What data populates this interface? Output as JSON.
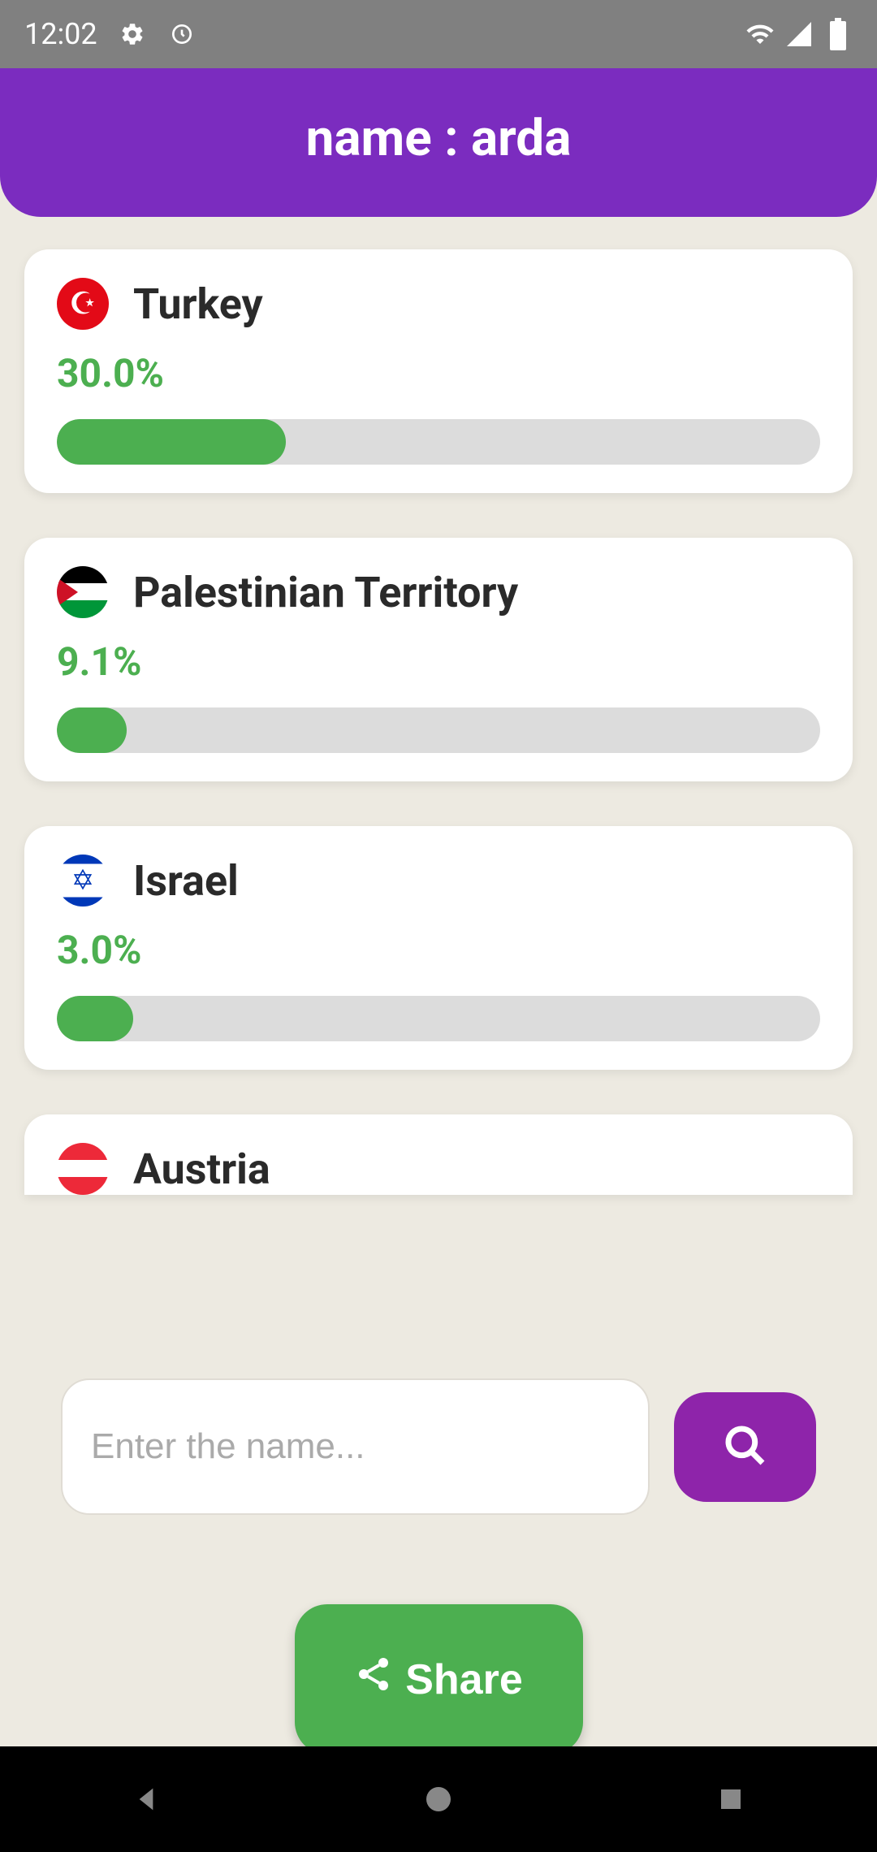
{
  "status": {
    "time": "12:02"
  },
  "header": {
    "title": "name : arda"
  },
  "results": [
    {
      "country": "Turkey",
      "percentage": "30.0%",
      "progress": 30.0
    },
    {
      "country": "Palestinian Territory",
      "percentage": "9.1%",
      "progress": 9.1
    },
    {
      "country": "Israel",
      "percentage": "3.0%",
      "progress": 10.0
    },
    {
      "country": "Austria",
      "percentage": "",
      "progress": 0
    }
  ],
  "search": {
    "placeholder": "Enter the name..."
  },
  "share": {
    "label": "Share"
  }
}
